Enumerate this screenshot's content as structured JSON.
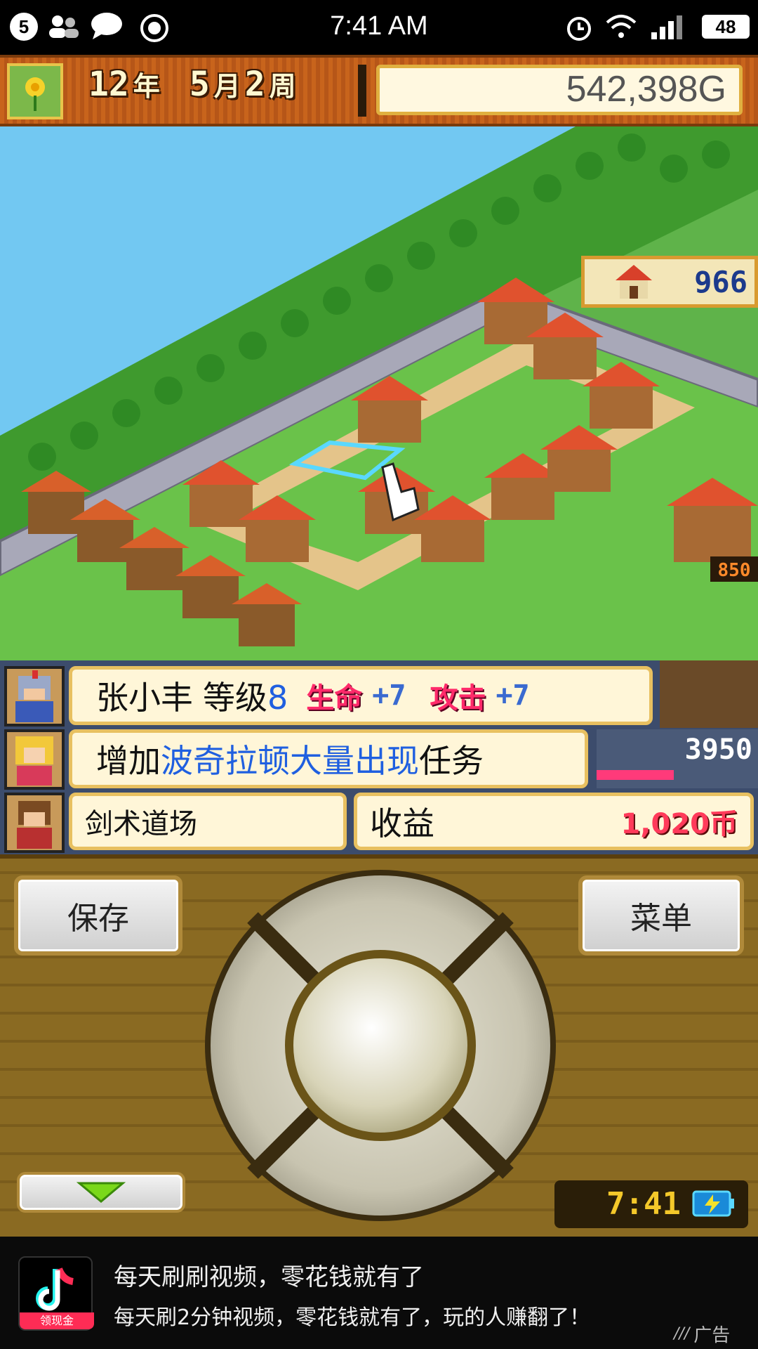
{
  "status_bar": {
    "notification_count": "5",
    "time": "7:41 AM",
    "battery": "48"
  },
  "top_bar": {
    "year_num": "12",
    "year_unit": "年",
    "month_num": "5",
    "month_unit": "月",
    "week_num": "2",
    "week_unit": "周",
    "money": "542,398G"
  },
  "map": {
    "population": "966",
    "building_income_tag": "850"
  },
  "messages": {
    "row1": {
      "name": "张小丰",
      "level_label": "等级",
      "level_value": "8",
      "stat1_label": "生命",
      "stat1_value": "+7",
      "stat2_label": "攻击",
      "stat2_value": "+7"
    },
    "row2": {
      "prefix": "增加",
      "highlight": "波奇拉顿大量出现",
      "suffix": "任务",
      "side_value": "3950"
    },
    "row3": {
      "facility": "剑术道场",
      "income_label": "收益",
      "income_value": "1,020币"
    }
  },
  "controls": {
    "save_label": "保存",
    "menu_label": "菜单",
    "clock": "7:41"
  },
  "ad": {
    "badge": "领现金",
    "headline": "每天刷刷视频，零花钱就有了",
    "subline": "每天刷2分钟视频，零花钱就有了，玩的人赚翻了！",
    "ad_label": "广告"
  }
}
